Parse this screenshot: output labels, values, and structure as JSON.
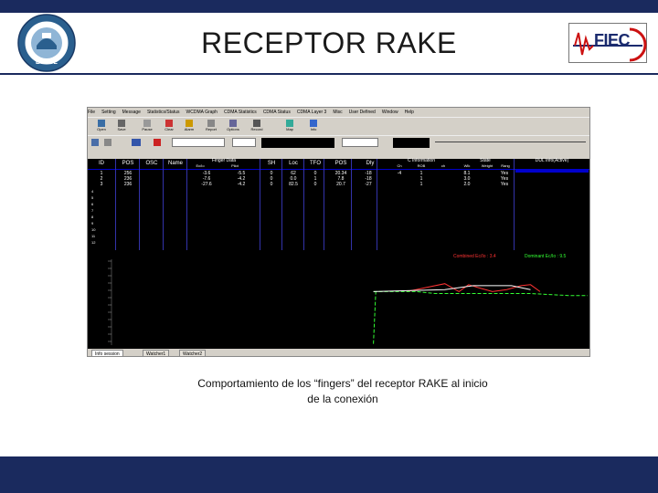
{
  "header": {
    "title": "RECEPTOR RAKE",
    "logo_left_text": "ESPOL",
    "logo_right_text": "FIEC"
  },
  "caption": {
    "line1": "Comportamiento de los “fingers” del receptor RAKE al inicio",
    "line2": "de la conexión"
  },
  "app": {
    "menu": [
      "File",
      "Setting",
      "Message",
      "Statistics/Status",
      "WCDMA Graph",
      "CDMA Statistics",
      "CDMA Status",
      "CDMA Layer 3",
      "Misc",
      "User Defined",
      "Window",
      "Help"
    ],
    "toolbar_buttons": [
      "Open",
      "Save",
      "Pause",
      "Clear",
      "Alarm",
      "Report",
      "Options",
      "Record",
      "Map",
      "Info"
    ],
    "table_headers": [
      "ID",
      "POS",
      "OSC",
      "Name",
      "Ec/Io",
      "SH",
      "Loc",
      "TFO",
      "POS",
      "Dly"
    ],
    "group_headers": {
      "finger": "Finger Data",
      "info": "C Information",
      "state": "State",
      "dul": "DUL Info(Active)"
    },
    "sub_headers": [
      "Ec/Io",
      "Pilot",
      "Ch",
      "ROB",
      "ch",
      "Wlk",
      "Weight",
      "Rang"
    ],
    "row_labels": [
      "1",
      "2",
      "3",
      "4",
      "5",
      "6",
      "7",
      "8",
      "9",
      "10",
      "11",
      "12"
    ],
    "rows": [
      [
        "1",
        "256",
        "",
        "",
        "-3.6",
        "-5.5",
        "0",
        "62",
        "0",
        "20.34",
        "-18",
        "-4",
        "1",
        "8.1",
        "Yes"
      ],
      [
        "2",
        "236",
        "",
        "",
        "-7.6",
        "-4.2",
        "0",
        "0.0",
        "1",
        "7.8",
        "-18",
        "",
        "1",
        "3.0",
        "Yes"
      ],
      [
        "3",
        "236",
        "",
        "",
        "-27.6",
        "-4.2",
        "0",
        "82.5",
        "0",
        "20.7",
        "-27",
        "",
        "1",
        "2.0",
        "Yes"
      ]
    ],
    "legend_combined": "Combined Ec/Io : 3.4",
    "legend_dominant": "Dominant Ec/Io : 9.5",
    "tabs": [
      "Info session",
      "Watcher1",
      "Watcher2"
    ]
  },
  "chart_data": {
    "type": "line",
    "title": "",
    "series": [
      {
        "color": "#ff3333",
        "points": [
          [
            0.62,
            0.42
          ],
          [
            0.66,
            0.38
          ],
          [
            0.7,
            0.34
          ],
          [
            0.73,
            0.42
          ],
          [
            0.75,
            0.35
          ],
          [
            0.77,
            0.38
          ],
          [
            0.8,
            0.42
          ],
          [
            0.83,
            0.4
          ],
          [
            0.86,
            0.36
          ],
          [
            0.88,
            0.35
          ],
          [
            0.9,
            0.42
          ]
        ]
      },
      {
        "color": "#33ff33",
        "points": [
          [
            0.55,
            0.42
          ],
          [
            0.58,
            0.42
          ],
          [
            0.6,
            0.42
          ],
          [
            0.64,
            0.42
          ],
          [
            0.68,
            0.44
          ],
          [
            0.72,
            0.44
          ],
          [
            0.76,
            0.44
          ],
          [
            0.8,
            0.44
          ],
          [
            0.84,
            0.44
          ],
          [
            0.88,
            0.44
          ],
          [
            0.92,
            0.45
          ],
          [
            0.96,
            0.46
          ],
          [
            1.0,
            0.46
          ]
        ]
      },
      {
        "color": "#33ff33",
        "points": [
          [
            0.55,
            0.95
          ],
          [
            0.555,
            0.42
          ]
        ]
      },
      {
        "color": "#ffffff",
        "points": [
          [
            0.55,
            0.42
          ],
          [
            0.7,
            0.4
          ],
          [
            0.76,
            0.36
          ],
          [
            0.84,
            0.36
          ],
          [
            0.88,
            0.4
          ]
        ]
      }
    ]
  }
}
